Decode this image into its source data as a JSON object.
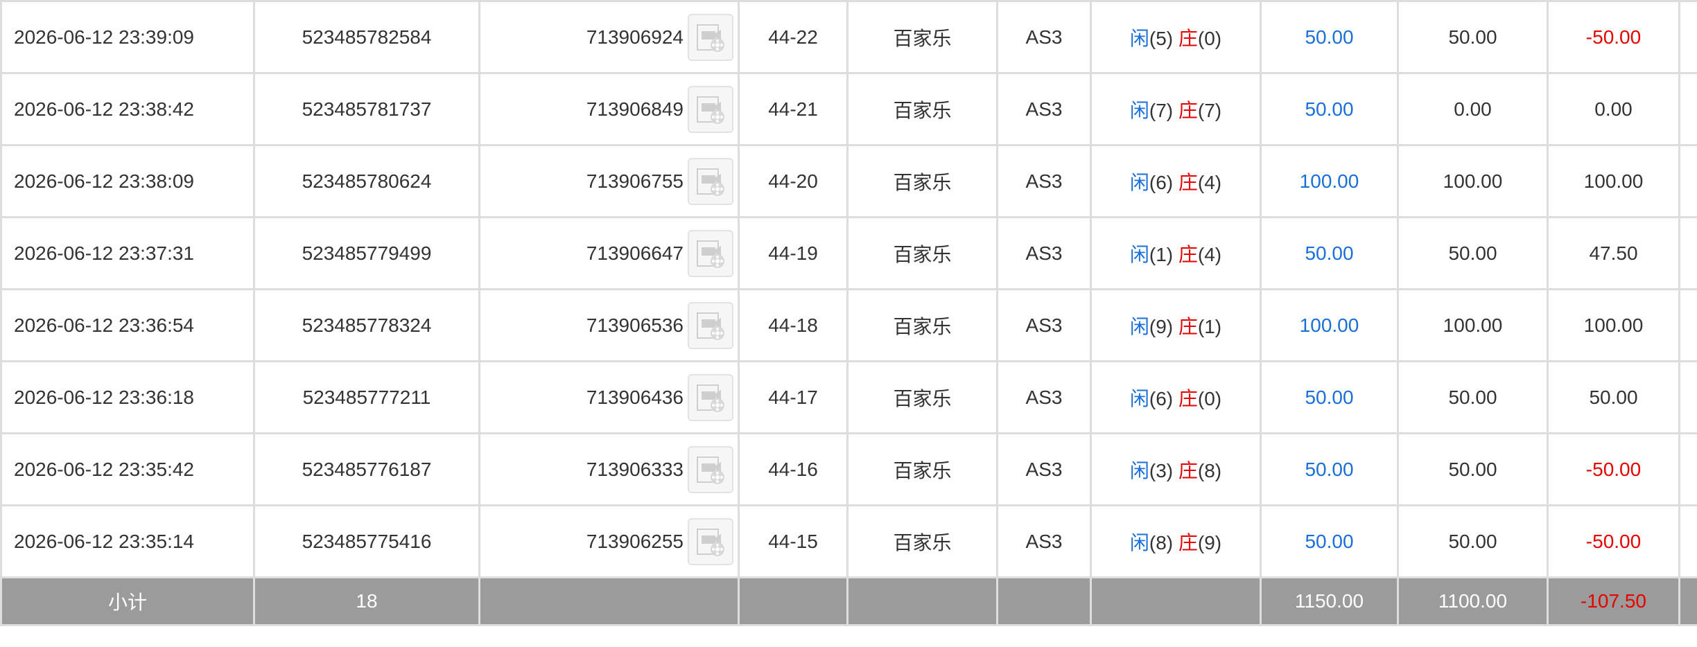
{
  "rows": [
    {
      "time": "2026-06-12 23:39:09",
      "bet_id": "523485782584",
      "round_id": "713906924",
      "shoe": "44-22",
      "game": "百家乐",
      "table": "AS3",
      "player_label": "闲",
      "player_score": "(5)",
      "banker_label": "庄",
      "banker_score": "(0)",
      "bet_amount": "50.00",
      "valid_bet": "50.00",
      "win_loss": "-50.00",
      "win_loss_color": "red"
    },
    {
      "time": "2026-06-12 23:38:42",
      "bet_id": "523485781737",
      "round_id": "713906849",
      "shoe": "44-21",
      "game": "百家乐",
      "table": "AS3",
      "player_label": "闲",
      "player_score": "(7)",
      "banker_label": "庄",
      "banker_score": "(7)",
      "bet_amount": "50.00",
      "valid_bet": "0.00",
      "win_loss": "0.00",
      "win_loss_color": "normal"
    },
    {
      "time": "2026-06-12 23:38:09",
      "bet_id": "523485780624",
      "round_id": "713906755",
      "shoe": "44-20",
      "game": "百家乐",
      "table": "AS3",
      "player_label": "闲",
      "player_score": "(6)",
      "banker_label": "庄",
      "banker_score": "(4)",
      "bet_amount": "100.00",
      "valid_bet": "100.00",
      "win_loss": "100.00",
      "win_loss_color": "normal"
    },
    {
      "time": "2026-06-12 23:37:31",
      "bet_id": "523485779499",
      "round_id": "713906647",
      "shoe": "44-19",
      "game": "百家乐",
      "table": "AS3",
      "player_label": "闲",
      "player_score": "(1)",
      "banker_label": "庄",
      "banker_score": "(4)",
      "bet_amount": "50.00",
      "valid_bet": "50.00",
      "win_loss": "47.50",
      "win_loss_color": "normal"
    },
    {
      "time": "2026-06-12 23:36:54",
      "bet_id": "523485778324",
      "round_id": "713906536",
      "shoe": "44-18",
      "game": "百家乐",
      "table": "AS3",
      "player_label": "闲",
      "player_score": "(9)",
      "banker_label": "庄",
      "banker_score": "(1)",
      "bet_amount": "100.00",
      "valid_bet": "100.00",
      "win_loss": "100.00",
      "win_loss_color": "normal"
    },
    {
      "time": "2026-06-12 23:36:18",
      "bet_id": "523485777211",
      "round_id": "713906436",
      "shoe": "44-17",
      "game": "百家乐",
      "table": "AS3",
      "player_label": "闲",
      "player_score": "(6)",
      "banker_label": "庄",
      "banker_score": "(0)",
      "bet_amount": "50.00",
      "valid_bet": "50.00",
      "win_loss": "50.00",
      "win_loss_color": "normal"
    },
    {
      "time": "2026-06-12 23:35:42",
      "bet_id": "523485776187",
      "round_id": "713906333",
      "shoe": "44-16",
      "game": "百家乐",
      "table": "AS3",
      "player_label": "闲",
      "player_score": "(3)",
      "banker_label": "庄",
      "banker_score": "(8)",
      "bet_amount": "50.00",
      "valid_bet": "50.00",
      "win_loss": "-50.00",
      "win_loss_color": "red"
    },
    {
      "time": "2026-06-12 23:35:14",
      "bet_id": "523485775416",
      "round_id": "713906255",
      "shoe": "44-15",
      "game": "百家乐",
      "table": "AS3",
      "player_label": "闲",
      "player_score": "(8)",
      "banker_label": "庄",
      "banker_score": "(9)",
      "bet_amount": "50.00",
      "valid_bet": "50.00",
      "win_loss": "-50.00",
      "win_loss_color": "red"
    }
  ],
  "subtotal": {
    "label": "小计",
    "count": "18",
    "bet_amount": "1150.00",
    "valid_bet": "1100.00",
    "win_loss": "-107.50"
  },
  "icons": {
    "replay": "video-replay-icon"
  },
  "colors": {
    "blue": "#1a6fd8",
    "red": "#e60000",
    "subtotal_bg": "#9b9b9b",
    "border": "#dddddd"
  }
}
